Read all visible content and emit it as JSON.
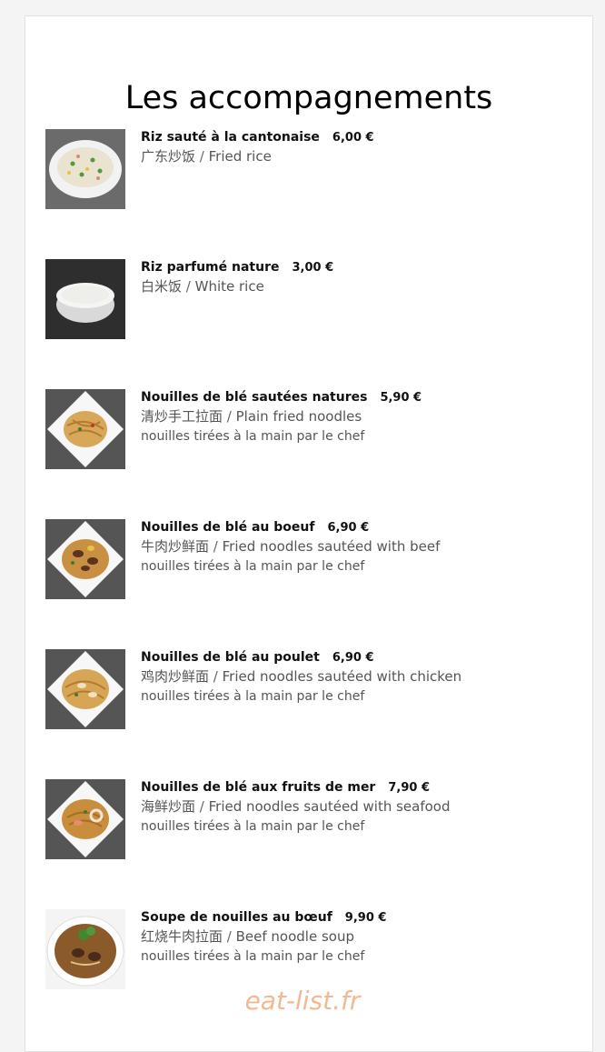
{
  "page": {
    "title": "Les accompagnements",
    "watermark": "eat-list.fr"
  },
  "items": [
    {
      "name": "Riz sauté à la cantonaise",
      "price": "6,00 €",
      "chinese": "广东炒饭",
      "english": "Fried rice",
      "note": "",
      "image": "fried-rice-photo"
    },
    {
      "name": "Riz parfumé nature",
      "price": "3,00 €",
      "chinese": "白米饭",
      "english": "White rice",
      "note": "",
      "image": "white-rice-photo"
    },
    {
      "name": "Nouilles de blé sautées natures",
      "price": "5,90 €",
      "chinese": "清炒手工拉面",
      "english": "Plain fried noodles",
      "note": "nouilles tirées à la main par le chef",
      "image": "plain-noodles-photo"
    },
    {
      "name": "Nouilles de blé au boeuf",
      "price": "6,90 €",
      "chinese": "牛肉炒鲜面",
      "english": "Fried noodles sautéed with beef",
      "note": "nouilles tirées à la main par le chef",
      "image": "beef-noodles-photo"
    },
    {
      "name": "Nouilles de blé au poulet",
      "price": "6,90 €",
      "chinese": "鸡肉炒鲜面",
      "english": "Fried noodles sautéed with chicken",
      "note": "nouilles tirées à la main par le chef",
      "image": "chicken-noodles-photo"
    },
    {
      "name": "Nouilles de blé aux fruits de mer",
      "price": "7,90 €",
      "chinese": "海鲜炒面",
      "english": "Fried noodles sautéed with seafood",
      "note": "nouilles tirées à la main par le chef",
      "image": "seafood-noodles-photo"
    },
    {
      "name": "Soupe de nouilles au bœuf",
      "price": "9,90 €",
      "chinese": "红烧牛肉拉面",
      "english": "Beef noodle soup",
      "note": "nouilles tirées à la main par le chef",
      "image": "beef-noodle-soup-photo"
    }
  ]
}
